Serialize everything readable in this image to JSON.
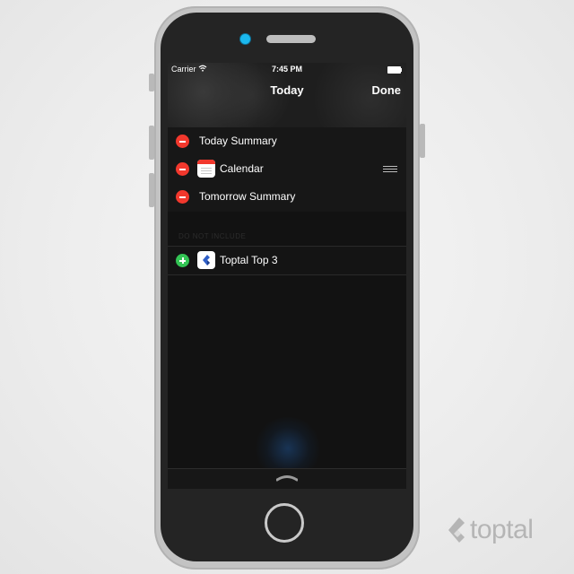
{
  "status_bar": {
    "carrier": "Carrier",
    "time": "7:45 PM",
    "wifi_icon": "wifi-icon",
    "battery_icon": "battery-icon"
  },
  "nav": {
    "title": "Today",
    "done_label": "Done"
  },
  "included_widgets": [
    {
      "label": "Today Summary",
      "control_icon": "minus-circle-icon"
    },
    {
      "label": "Calendar",
      "control_icon": "minus-circle-icon",
      "app_icon": "calendar-icon",
      "reorder_icon": "drag-handle-icon"
    },
    {
      "label": "Tomorrow Summary",
      "control_icon": "minus-circle-icon"
    }
  ],
  "excluded_section": {
    "header": "DO NOT INCLUDE",
    "widgets": [
      {
        "label": "Toptal Top 3",
        "control_icon": "plus-circle-icon",
        "app_icon": "toptal-icon"
      }
    ]
  },
  "bottom": {
    "grabber_icon": "chevron-up-icon"
  },
  "watermark": {
    "text": "toptal",
    "logo_icon": "toptal-logo-icon"
  },
  "colors": {
    "remove": "#f2382d",
    "add": "#33c454",
    "camera": "#1bb8ee",
    "screen": "#121212"
  }
}
